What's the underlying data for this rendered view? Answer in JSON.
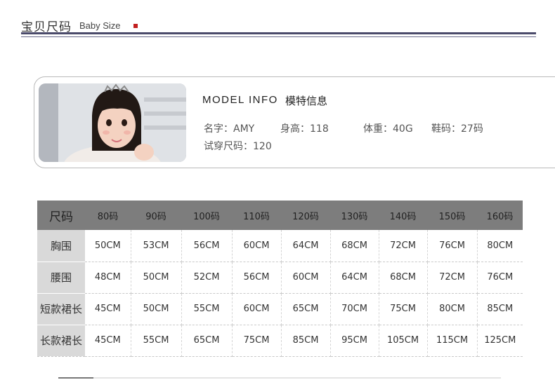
{
  "header": {
    "title_cn": "宝贝尺码",
    "title_en": "Baby Size"
  },
  "model": {
    "heading_en": "MODEL INFO",
    "heading_cn": "模特信息",
    "name_label": "名字：",
    "name_value": "AMY",
    "height_label": "身高：",
    "height_value": "118",
    "weight_label": "体重：",
    "weight_value": "40G",
    "shoe_label": "鞋码：",
    "shoe_value": "27码",
    "tried_label": "试穿尺码：",
    "tried_value": "120"
  },
  "size_table": {
    "corner": "尺码",
    "columns": [
      "80码",
      "90码",
      "100码",
      "110码",
      "120码",
      "130码",
      "140码",
      "150码",
      "160码"
    ],
    "rows": [
      {
        "label": "胸围",
        "values": [
          "50CM",
          "53CM",
          "56CM",
          "60CM",
          "64CM",
          "68CM",
          "72CM",
          "76CM",
          "80CM"
        ]
      },
      {
        "label": "腰围",
        "values": [
          "48CM",
          "50CM",
          "52CM",
          "56CM",
          "60CM",
          "64CM",
          "68CM",
          "72CM",
          "76CM"
        ]
      },
      {
        "label": "短款裙长",
        "values": [
          "45CM",
          "50CM",
          "55CM",
          "60CM",
          "65CM",
          "70CM",
          "75CM",
          "80CM",
          "85CM"
        ]
      },
      {
        "label": "长款裙长",
        "values": [
          "45CM",
          "55CM",
          "65CM",
          "75CM",
          "85CM",
          "95CM",
          "105CM",
          "115CM",
          "125CM"
        ]
      }
    ]
  },
  "colors": {
    "accent_square": "#c21f1f",
    "rule": "#4a4a6a",
    "table_header": "#7d7d7d",
    "row_header": "#d9d9d9"
  }
}
